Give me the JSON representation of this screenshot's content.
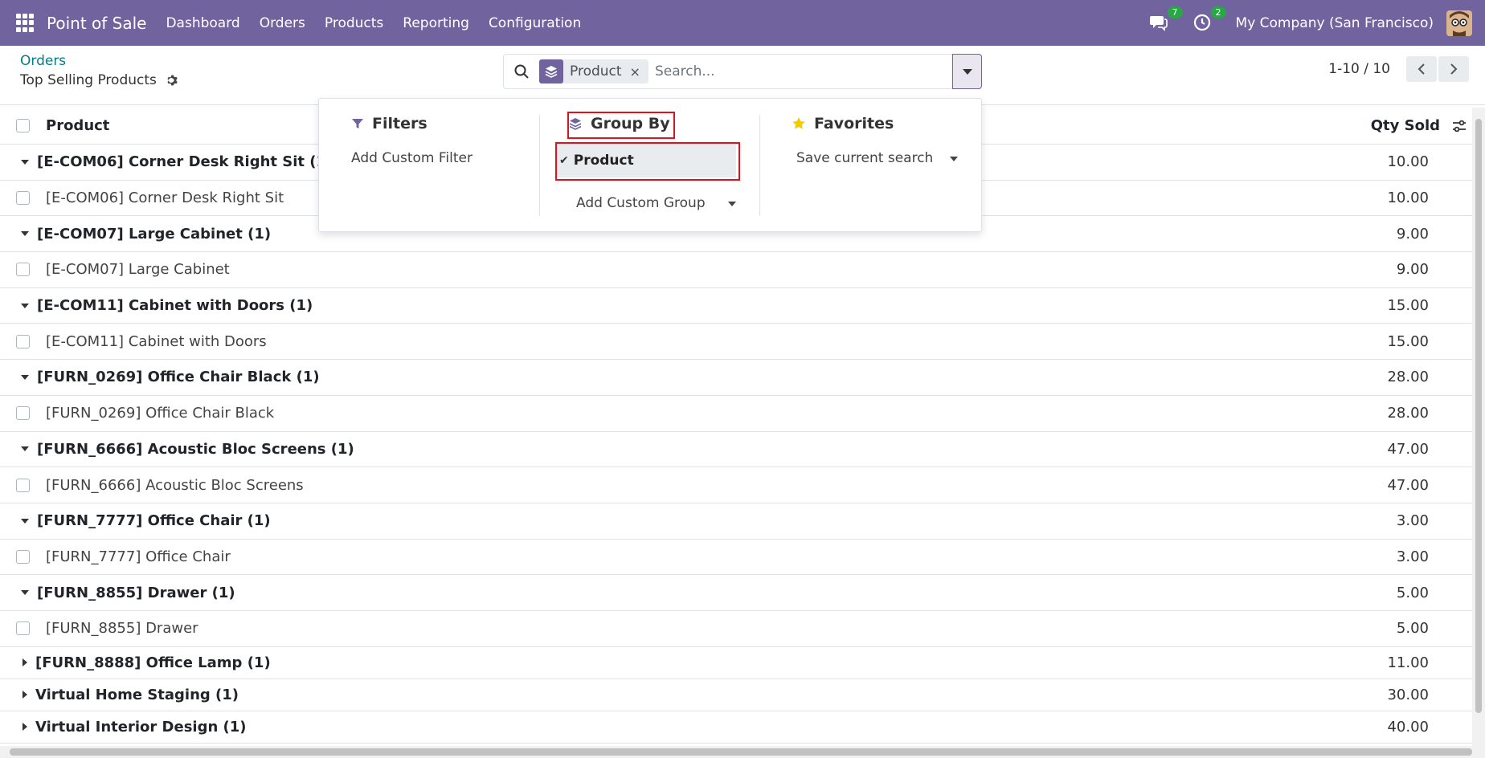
{
  "topbar": {
    "app_name": "Point of Sale",
    "menu": [
      "Dashboard",
      "Orders",
      "Products",
      "Reporting",
      "Configuration"
    ],
    "messages_count": "7",
    "activities_count": "2",
    "company": "My Company (San Francisco)",
    "bg_color": "#71639e"
  },
  "control_panel": {
    "breadcrumb": "Orders",
    "title": "Top Selling Products",
    "search": {
      "facet_label": "Product",
      "placeholder": "Search..."
    },
    "pager": "1-10 / 10"
  },
  "list": {
    "columns": {
      "product": "Product",
      "qty": "Qty Sold"
    },
    "groups": [
      {
        "label": "[E-COM06] Corner Desk Right Sit (1)",
        "qty": "10.00",
        "expanded": true,
        "record": {
          "name": "[E-COM06] Corner Desk Right Sit",
          "qty": "10.00"
        }
      },
      {
        "label": "[E-COM07] Large Cabinet (1)",
        "qty": "9.00",
        "expanded": true,
        "record": {
          "name": "[E-COM07] Large Cabinet",
          "qty": "9.00"
        }
      },
      {
        "label": "[E-COM11] Cabinet with Doors (1)",
        "qty": "15.00",
        "expanded": true,
        "record": {
          "name": "[E-COM11] Cabinet with Doors",
          "qty": "15.00"
        }
      },
      {
        "label": "[FURN_0269] Office Chair Black (1)",
        "qty": "28.00",
        "expanded": true,
        "record": {
          "name": "[FURN_0269] Office Chair Black",
          "qty": "28.00"
        }
      },
      {
        "label": "[FURN_6666] Acoustic Bloc Screens (1)",
        "qty": "47.00",
        "expanded": true,
        "record": {
          "name": "[FURN_6666] Acoustic Bloc Screens",
          "qty": "47.00"
        }
      },
      {
        "label": "[FURN_7777] Office Chair (1)",
        "qty": "3.00",
        "expanded": true,
        "record": {
          "name": "[FURN_7777] Office Chair",
          "qty": "3.00"
        }
      },
      {
        "label": "[FURN_8855] Drawer (1)",
        "qty": "5.00",
        "expanded": true,
        "record": {
          "name": "[FURN_8855] Drawer",
          "qty": "5.00"
        }
      },
      {
        "label": "[FURN_8888] Office Lamp (1)",
        "qty": "11.00",
        "expanded": false
      },
      {
        "label": "Virtual Home Staging (1)",
        "qty": "30.00",
        "expanded": false
      },
      {
        "label": "Virtual Interior Design (1)",
        "qty": "40.00",
        "expanded": false
      }
    ]
  },
  "dropdown": {
    "filters": {
      "title": "Filters",
      "add_custom": "Add Custom Filter"
    },
    "group_by": {
      "title": "Group By",
      "selected": "Product",
      "add_custom": "Add Custom Group"
    },
    "favorites": {
      "title": "Favorites",
      "save": "Save current search"
    },
    "highlight_color": "#e0101d"
  }
}
